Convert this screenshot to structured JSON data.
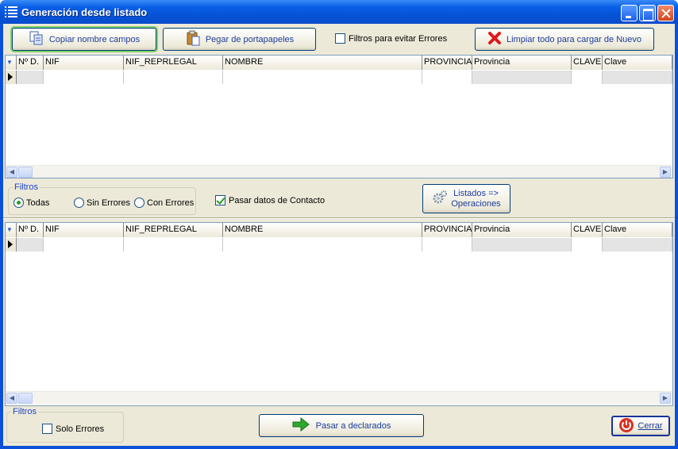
{
  "window": {
    "title": "Generación desde listado"
  },
  "toolbar": {
    "copy_fields_label": "Copiar nombre campos",
    "paste_label": "Pegar de portapapeles",
    "error_filter_label": "Filtros para evitar Errores",
    "clear_label": "Limpiar todo para cargar de Nuevo"
  },
  "grid_columns": [
    "Nº D.",
    "NIF",
    "NIF_REPRLEGAL",
    "NOMBRE",
    "PROVINCIA",
    "Provincia",
    "CLAVE",
    "Clave"
  ],
  "filters": {
    "legend": "Filtros",
    "all_label": "Todas",
    "no_errors_label": "Sin Errores",
    "with_errors_label": "Con Errores",
    "selected": "Todas"
  },
  "contact": {
    "label": "Pasar datos de Contacto",
    "checked": true
  },
  "listados_button": {
    "line1": "Listados =>",
    "line2": "Operaciones"
  },
  "bottom": {
    "filters_legend": "Filtros",
    "only_errors_label": "Solo Errores",
    "pass_label": "Pasar a declarados",
    "close_label": "Cerrar"
  },
  "colors": {
    "titlebar": "#0a5fe6",
    "client_bg": "#ece9d8",
    "button_text": "#1d3c9a",
    "focus_ring": "#7ed36b"
  }
}
